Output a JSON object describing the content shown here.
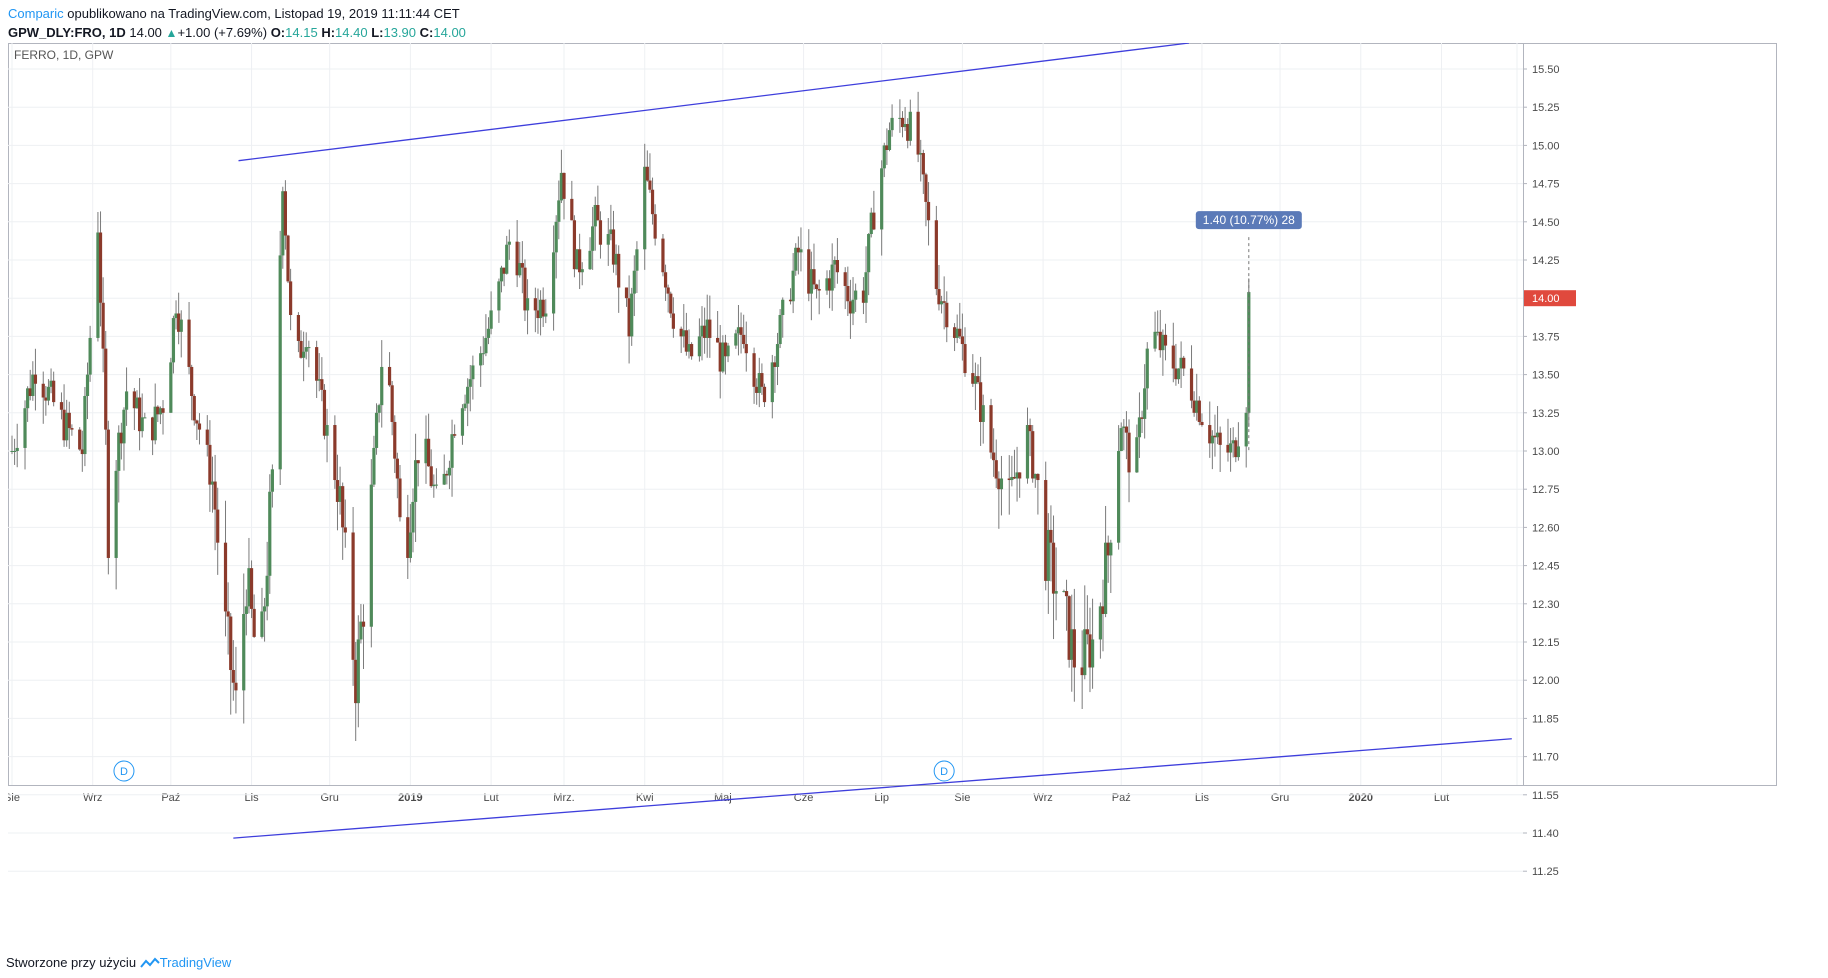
{
  "header": {
    "publisher": "Comparic",
    "published_text": "opublikowano na TradingView.com, Listopad 19, 2019 11:11:44 CET",
    "symbol": "GPW_DLY:FRO, 1D",
    "last": "14.00",
    "change": "+1.00 (+7.69%)",
    "o_label": "O:",
    "o": "14.15",
    "h_label": "H:",
    "h": "14.40",
    "l_label": "L:",
    "l": "13.90",
    "c_label": "C:",
    "c": "14.00"
  },
  "footer": {
    "text": "Stworzone przy użyciu",
    "brand": "TradingView"
  },
  "colors": {
    "up": "#4f8a5a",
    "down": "#8b3a2b",
    "trend": "#3e3edc",
    "accent": "#2196f3",
    "price_tag": "#e0493d",
    "measure": "#5b7ab8"
  },
  "chart_data": {
    "type": "candlestick",
    "title": "FERRO, 1D, GPW",
    "y_ticks": [
      "15.50",
      "15.25",
      "15.00",
      "14.75",
      "14.50",
      "14.25",
      "14.00",
      "13.75",
      "13.50",
      "13.25",
      "13.00",
      "12.75",
      "12.60",
      "12.45",
      "12.30",
      "12.15",
      "12.00",
      "11.85",
      "11.70",
      "11.55",
      "11.40",
      "11.25"
    ],
    "x_labels": [
      "Sie",
      "Wrz",
      "Paź",
      "Lis",
      "Gru",
      "2019",
      "Lut",
      "Mrz.",
      "Kwi",
      "Maj",
      "Cze",
      "Lip",
      "Sie",
      "Wrz",
      "Paź",
      "Lis",
      "Gru",
      "2020",
      "Lut"
    ],
    "x_range": [
      "2018-08-01",
      "2020-03-01"
    ],
    "current_price": "14.00",
    "measure_label": "1.40 (10.77%) 28",
    "dividend_marker": "D",
    "dividend_dates": [
      "2018-09-13",
      "2019-07-25"
    ],
    "trendlines": [
      {
        "from": [
          "2018-10-27",
          14.9
        ],
        "to": [
          "2019-10-27",
          15.67
        ]
      },
      {
        "from": [
          "2018-10-25",
          11.38
        ],
        "to": [
          "2020-02-28",
          11.77
        ]
      }
    ],
    "price_path": [
      [
        "2018-08-01",
        13.0
      ],
      [
        "2018-08-10",
        13.55
      ],
      [
        "2018-08-20",
        13.2
      ],
      [
        "2018-08-28",
        13.0
      ],
      [
        "2018-09-03",
        14.5
      ],
      [
        "2018-09-07",
        12.6
      ],
      [
        "2018-09-14",
        13.4
      ],
      [
        "2018-09-22",
        13.1
      ],
      [
        "2018-09-29",
        13.35
      ],
      [
        "2018-10-03",
        14.0
      ],
      [
        "2018-10-10",
        13.3
      ],
      [
        "2018-10-17",
        12.8
      ],
      [
        "2018-10-22",
        12.2
      ],
      [
        "2018-10-26",
        11.9
      ],
      [
        "2018-10-30",
        12.4
      ],
      [
        "2018-11-04",
        12.0
      ],
      [
        "2018-11-09",
        12.8
      ],
      [
        "2018-11-13",
        14.8
      ],
      [
        "2018-11-17",
        13.5
      ],
      [
        "2018-11-22",
        13.8
      ],
      [
        "2018-11-29",
        13.2
      ],
      [
        "2018-12-05",
        12.7
      ],
      [
        "2018-12-11",
        12.0
      ],
      [
        "2018-12-16",
        12.5
      ],
      [
        "2018-12-22",
        13.8
      ],
      [
        "2018-12-29",
        12.4
      ],
      [
        "2019-01-05",
        13.1
      ],
      [
        "2019-01-12",
        12.6
      ],
      [
        "2019-01-19",
        13.3
      ],
      [
        "2019-01-26",
        13.55
      ],
      [
        "2019-02-02",
        13.9
      ],
      [
        "2019-02-09",
        14.45
      ],
      [
        "2019-02-15",
        13.9
      ],
      [
        "2019-02-22",
        14.0
      ],
      [
        "2019-02-28",
        14.85
      ],
      [
        "2019-03-06",
        14.2
      ],
      [
        "2019-03-13",
        14.5
      ],
      [
        "2019-03-20",
        14.3
      ],
      [
        "2019-03-26",
        13.8
      ],
      [
        "2019-04-01",
        14.8
      ],
      [
        "2019-04-06",
        14.4
      ],
      [
        "2019-04-12",
        13.9
      ],
      [
        "2019-04-18",
        13.6
      ],
      [
        "2019-04-25",
        13.8
      ],
      [
        "2019-05-02",
        13.55
      ],
      [
        "2019-05-09",
        13.8
      ],
      [
        "2019-05-16",
        13.35
      ],
      [
        "2019-05-23",
        13.8
      ],
      [
        "2019-05-30",
        14.3
      ],
      [
        "2019-06-06",
        14.0
      ],
      [
        "2019-06-13",
        14.2
      ],
      [
        "2019-06-19",
        14.0
      ],
      [
        "2019-06-24",
        14.05
      ],
      [
        "2019-06-29",
        14.7
      ],
      [
        "2019-07-04",
        15.1
      ],
      [
        "2019-07-10",
        15.2
      ],
      [
        "2019-07-15",
        14.95
      ],
      [
        "2019-07-22",
        14.1
      ],
      [
        "2019-07-29",
        13.8
      ],
      [
        "2019-08-05",
        13.5
      ],
      [
        "2019-08-12",
        13.0
      ],
      [
        "2019-08-19",
        12.7
      ],
      [
        "2019-08-26",
        13.1
      ],
      [
        "2019-09-02",
        12.5
      ],
      [
        "2019-09-08",
        12.3
      ],
      [
        "2019-09-14",
        12.05
      ],
      [
        "2019-09-20",
        12.15
      ],
      [
        "2019-09-26",
        12.5
      ],
      [
        "2019-10-01",
        13.2
      ],
      [
        "2019-10-06",
        12.8
      ],
      [
        "2019-10-12",
        13.8
      ],
      [
        "2019-10-19",
        13.6
      ],
      [
        "2019-10-26",
        13.5
      ],
      [
        "2019-11-02",
        13.2
      ],
      [
        "2019-11-08",
        13.0
      ],
      [
        "2019-11-13",
        13.0
      ],
      [
        "2019-11-18",
        13.35
      ],
      [
        "2019-11-19",
        14.0
      ]
    ]
  }
}
